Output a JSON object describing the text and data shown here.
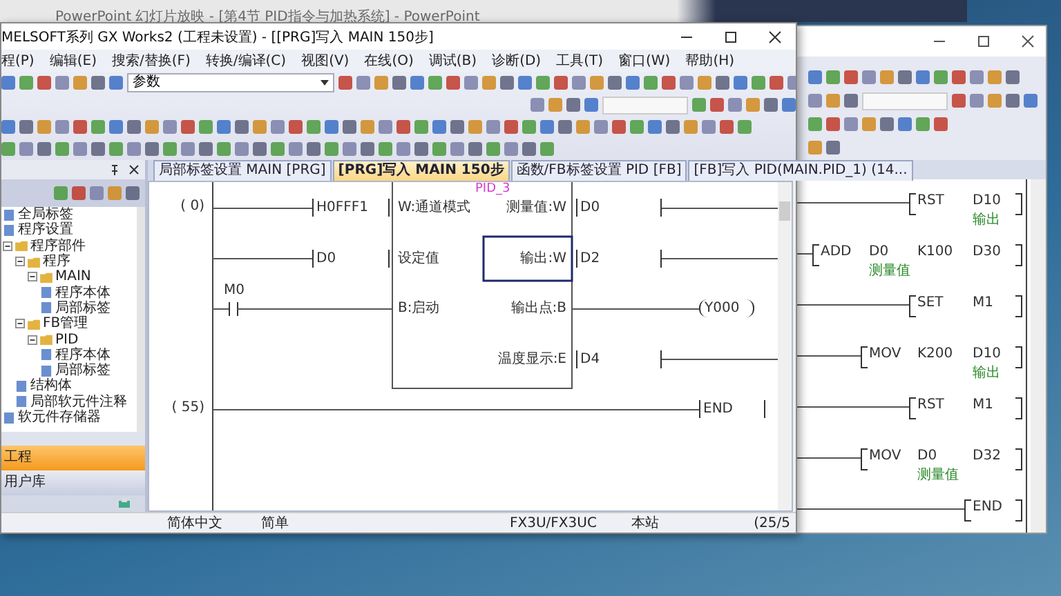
{
  "background_window": {
    "title": "PowerPoint 幻灯片放映 - [第4节 PID指令与加热系统] - PowerPoint"
  },
  "back_window": {
    "rungs": [
      {
        "instruction": "RST",
        "operands": [
          {
            "device": "D10",
            "comment": "输出"
          }
        ]
      },
      {
        "instruction": "ADD",
        "operands": [
          {
            "device": "D0",
            "comment": "测量值"
          },
          {
            "device": "K100"
          },
          {
            "device": "D30"
          }
        ]
      },
      {
        "instruction": "SET",
        "operands": [
          {
            "device": "M1"
          }
        ]
      },
      {
        "instruction": "MOV",
        "operands": [
          {
            "device": "K200"
          },
          {
            "device": "D10",
            "comment": "输出"
          }
        ]
      },
      {
        "instruction": "RST",
        "operands": [
          {
            "device": "M1"
          }
        ]
      },
      {
        "instruction": "MOV",
        "operands": [
          {
            "device": "D0",
            "comment": "测量值"
          },
          {
            "device": "D32"
          }
        ]
      },
      {
        "instruction": "END"
      }
    ]
  },
  "main_window": {
    "title": "MELSOFT系列 GX Works2 (工程未设置) - [[PRG]写入 MAIN 150步]",
    "menu": [
      "程(P)",
      "编辑(E)",
      "搜索/替换(F)",
      "转换/编译(C)",
      "视图(V)",
      "在线(O)",
      "调试(B)",
      "诊断(D)",
      "工具(T)",
      "窗口(W)",
      "帮助(H)"
    ],
    "search_combo": {
      "value": "参数"
    },
    "tabs": [
      {
        "label": "局部标签设置 MAIN [PRG]",
        "selected": false
      },
      {
        "label": "[PRG]写入 MAIN 150步",
        "selected": true
      },
      {
        "label": "函数/FB标签设置 PID [FB]",
        "selected": false
      },
      {
        "label": "[FB]写入 PID(MAIN.PID_1) (14...",
        "selected": false
      }
    ],
    "navigator": {
      "tree": [
        {
          "label": "全局标签"
        },
        {
          "label": "程序设置"
        },
        {
          "label": "程序部件",
          "expanded": true,
          "children": [
            {
              "label": "程序",
              "expanded": true,
              "children": [
                {
                  "label": "MAIN",
                  "expanded": true,
                  "children": [
                    {
                      "label": "程序本体"
                    },
                    {
                      "label": "局部标签"
                    }
                  ]
                }
              ]
            },
            {
              "label": "FB管理",
              "expanded": true,
              "children": [
                {
                  "label": "PID",
                  "expanded": true,
                  "children": [
                    {
                      "label": "程序本体"
                    },
                    {
                      "label": "局部标签"
                    }
                  ]
                }
              ]
            },
            {
              "label": "结构体"
            },
            {
              "label": "局部软元件注释"
            }
          ]
        },
        {
          "label": "软元件存储器"
        }
      ],
      "sections": [
        {
          "label": "工程",
          "selected": true
        },
        {
          "label": "用户库",
          "selected": false
        }
      ]
    },
    "ladder": {
      "steps": [
        "( 0)",
        "( 55)"
      ],
      "fb": {
        "name": "PID_3",
        "inputs": [
          {
            "label": "W:通道模式",
            "operand": "H0FFF1",
            "kind": "word"
          },
          {
            "label": "设定值",
            "operand": "D0",
            "kind": "word"
          },
          {
            "label": "B:启动",
            "operand": "M0",
            "kind": "contact"
          }
        ],
        "outputs": [
          {
            "label": "测量值:W",
            "operand": "D0",
            "kind": "word"
          },
          {
            "label": "输出:W",
            "operand": "D2",
            "kind": "word"
          },
          {
            "label": "输出点:B",
            "operand": "Y000",
            "kind": "coil"
          },
          {
            "label": "温度显示:E",
            "operand": "D4",
            "kind": "word"
          }
        ]
      },
      "end": "END"
    },
    "status_bar": [
      "简体中文",
      "简单",
      "FX3U/FX3UC",
      "本站",
      "(25/5"
    ]
  }
}
